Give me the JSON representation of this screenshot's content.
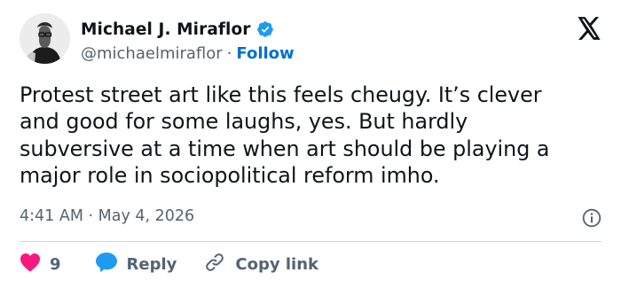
{
  "author": {
    "display_name": "Michael J. Miraflor",
    "handle": "@michaelmiraflor",
    "separator": "·",
    "follow_label": "Follow"
  },
  "tweet": {
    "text": "Protest street art like this feels cheugy. It’s clever\nand good for some laughs, yes. But hardly\nsubversive at a time when art should be playing a\nmajor role in sociopolitical reform imho.",
    "timestamp": "4:41 AM · May 4, 2026"
  },
  "actions": {
    "like_count": "9",
    "reply_label": "Reply",
    "copy_link_label": "Copy link"
  },
  "icons": {
    "verified": "verified-badge-icon",
    "logo": "x-logo-icon",
    "info": "info-icon",
    "like": "heart-icon",
    "reply": "speech-bubble-icon",
    "copy": "link-icon"
  },
  "colors": {
    "like": "#f91880",
    "reply": "#1d9bf0",
    "follow": "#006fd6",
    "muted": "#536471",
    "text": "#0f1419",
    "divider": "#cfd9de"
  }
}
